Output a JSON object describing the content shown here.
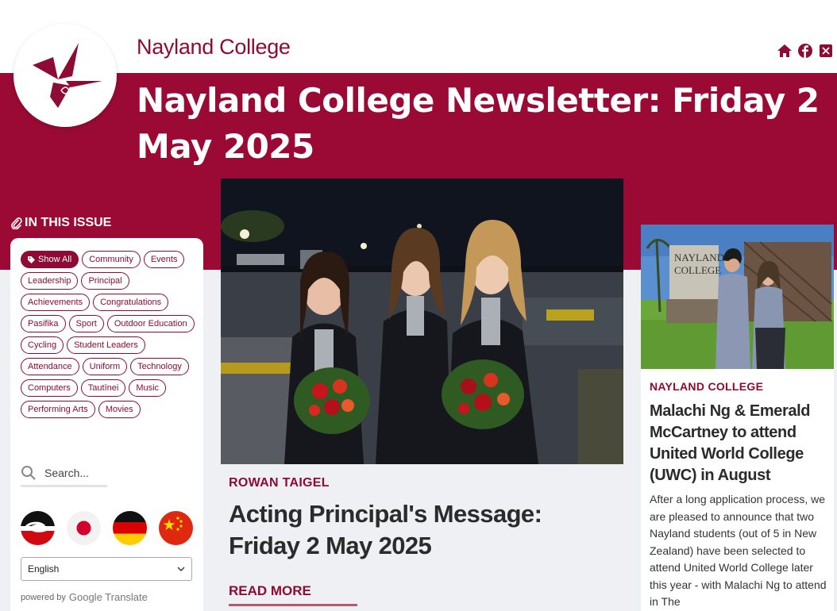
{
  "header": {
    "site_name": "Nayland College",
    "page_title": "Nayland College Newsletter: Friday 2 May 2025",
    "social": [
      "home-icon",
      "facebook-icon",
      "x-icon"
    ]
  },
  "sidebar": {
    "heading": "IN THIS ISSUE",
    "tags": [
      "Show All",
      "Community",
      "Events",
      "Leadership",
      "Principal",
      "Achievements",
      "Congratulations",
      "Pasifika",
      "Sport",
      "Outdoor Education",
      "Cycling",
      "Student Leaders",
      "Attendance",
      "Uniform",
      "Technology",
      "Computers",
      "Tautīnei",
      "Music",
      "Performing Arts",
      "Movies"
    ],
    "search_placeholder": "Search...",
    "language_flags": [
      "maori-flag-icon",
      "japan-flag-icon",
      "germany-flag-icon",
      "china-flag-icon"
    ],
    "language_select": "English",
    "powered_by": "powered by",
    "google_brand": "Google Translate"
  },
  "feature": {
    "author": "ROWAN TAIGEL",
    "title": "Acting Principal's Message: Friday 2 May 2025",
    "read_more": "READ MORE"
  },
  "card": {
    "author": "NAYLAND COLLEGE",
    "title": "Malachi Ng & Emerald McCartney to attend United World College (UWC) in August",
    "body": "After a long application process, we are pleased to announce that two Nayland students (out of 5 in New Zealand) have been selected to attend United World College later this year - with Malachi Ng to attend in The"
  },
  "colors": {
    "brand": "#9a0a35",
    "accent": "#8e0b33"
  }
}
